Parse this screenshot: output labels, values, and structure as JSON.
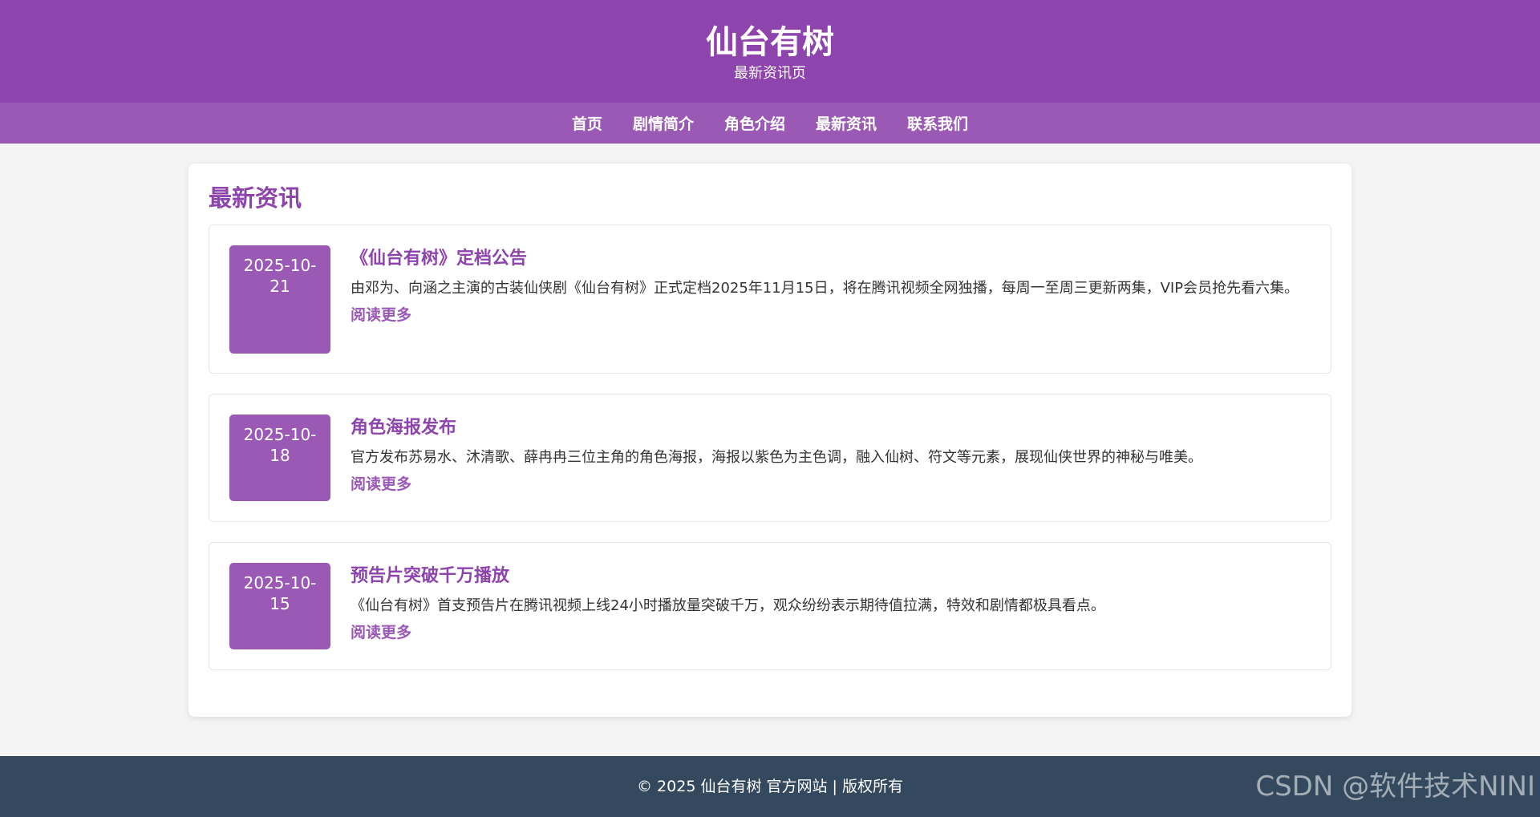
{
  "header": {
    "title": "仙台有树",
    "subtitle": "最新资讯页"
  },
  "nav": {
    "items": [
      "首页",
      "剧情简介",
      "角色介绍",
      "最新资讯",
      "联系我们"
    ]
  },
  "main": {
    "section_title": "最新资讯",
    "news": [
      {
        "date_line1": "2025-10-",
        "date_line2": "21",
        "title": "《仙台有树》定档公告",
        "description": "由邓为、向涵之主演的古装仙侠剧《仙台有树》正式定档2025年11月15日，将在腾讯视频全网独播，每周一至周三更新两集，VIP会员抢先看六集。",
        "read_more": "阅读更多"
      },
      {
        "date_line1": "2025-10-",
        "date_line2": "18",
        "title": "角色海报发布",
        "description": "官方发布苏易水、沐清歌、薛冉冉三位主角的角色海报，海报以紫色为主色调，融入仙树、符文等元素，展现仙侠世界的神秘与唯美。",
        "read_more": "阅读更多"
      },
      {
        "date_line1": "2025-10-",
        "date_line2": "15",
        "title": "预告片突破千万播放",
        "description": "《仙台有树》首支预告片在腾讯视频上线24小时播放量突破千万，观众纷纷表示期待值拉满，特效和剧情都极具看点。",
        "read_more": "阅读更多"
      }
    ]
  },
  "footer": {
    "text": "© 2025 仙台有树 官方网站 | 版权所有"
  },
  "watermark": "CSDN @软件技术NINI",
  "colors": {
    "brand_purple": "#8e44ad",
    "nav_purple": "#9b59b6",
    "footer_bg": "#34495e",
    "page_bg": "#f4f4f4"
  }
}
